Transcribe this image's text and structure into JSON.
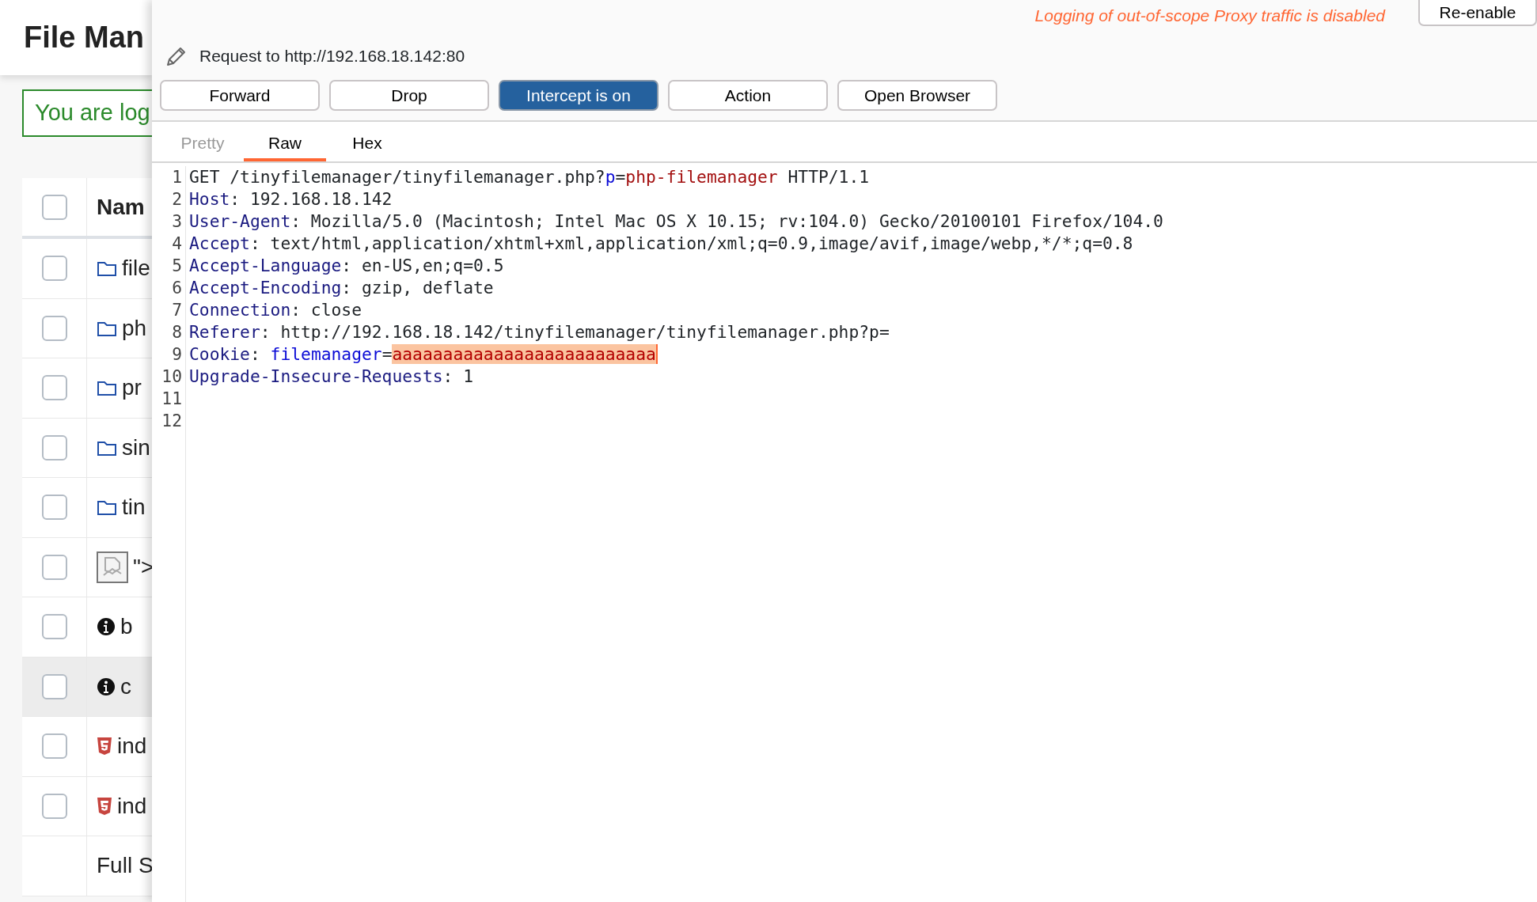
{
  "file_manager": {
    "title": "File Man",
    "alert": "You are log",
    "header": {
      "label": "Nam",
      "checked": false
    },
    "rows": [
      {
        "kind": "folder",
        "name": "file",
        "checked": false,
        "selected": false
      },
      {
        "kind": "folder",
        "name": "ph",
        "checked": false,
        "selected": false
      },
      {
        "kind": "folder",
        "name": "pr",
        "checked": false,
        "selected": false
      },
      {
        "kind": "folder",
        "name": "sin",
        "checked": false,
        "selected": false
      },
      {
        "kind": "folder",
        "name": "tin",
        "checked": false,
        "selected": false
      },
      {
        "kind": "image",
        "name": "\">",
        "checked": false,
        "selected": false
      },
      {
        "kind": "info",
        "name": "b",
        "checked": false,
        "selected": false
      },
      {
        "kind": "info",
        "name": "c",
        "checked": false,
        "selected": true
      },
      {
        "kind": "html",
        "name": "ind",
        "checked": false,
        "selected": false
      },
      {
        "kind": "html",
        "name": "ind",
        "checked": false,
        "selected": false
      },
      {
        "kind": "footer",
        "name": "Full S"
      }
    ]
  },
  "proxy": {
    "logging_notice": "Logging of out-of-scope Proxy traffic is disabled",
    "reenable_button": "Re-enable",
    "request_title": "Request to http://192.168.18.142:80",
    "buttons": [
      {
        "label": "Forward",
        "active": false
      },
      {
        "label": "Drop",
        "active": false
      },
      {
        "label": "Intercept is on",
        "active": true
      },
      {
        "label": "Action",
        "active": false
      },
      {
        "label": "Open Browser",
        "active": false
      }
    ],
    "tabs": [
      {
        "label": "Pretty",
        "selected": false,
        "disabled": true
      },
      {
        "label": "Raw",
        "selected": true,
        "disabled": false
      },
      {
        "label": "Hex",
        "selected": false,
        "disabled": false
      }
    ],
    "lines": [
      {
        "number": "1",
        "tokens": [
          {
            "kind": "plain",
            "text": "GET /tinyfilemanager/tinyfilemanager.php?"
          },
          {
            "kind": "param_name",
            "text": "p"
          },
          {
            "kind": "plain",
            "text": "="
          },
          {
            "kind": "param_value",
            "text": "php-filemanager"
          },
          {
            "kind": "plain",
            "text": " HTTP/1.1"
          }
        ]
      },
      {
        "number": "2",
        "tokens": [
          {
            "kind": "header",
            "text": "Host"
          },
          {
            "kind": "plain",
            "text": ": 192.168.18.142"
          }
        ]
      },
      {
        "number": "3",
        "tokens": [
          {
            "kind": "header",
            "text": "User-Agent"
          },
          {
            "kind": "plain",
            "text": ": Mozilla/5.0 (Macintosh; Intel Mac OS X 10.15; rv:104.0) Gecko/20100101 Firefox/104.0"
          }
        ]
      },
      {
        "number": "4",
        "tokens": [
          {
            "kind": "header",
            "text": "Accept"
          },
          {
            "kind": "plain",
            "text": ": text/html,application/xhtml+xml,application/xml;q=0.9,image/avif,image/webp,*/*;q=0.8"
          }
        ]
      },
      {
        "number": "5",
        "tokens": [
          {
            "kind": "header",
            "text": "Accept-Language"
          },
          {
            "kind": "plain",
            "text": ": en-US,en;q=0.5"
          }
        ]
      },
      {
        "number": "6",
        "tokens": [
          {
            "kind": "header",
            "text": "Accept-Encoding"
          },
          {
            "kind": "plain",
            "text": ": gzip, deflate"
          }
        ]
      },
      {
        "number": "7",
        "tokens": [
          {
            "kind": "header",
            "text": "Connection"
          },
          {
            "kind": "plain",
            "text": ": close"
          }
        ]
      },
      {
        "number": "8",
        "tokens": [
          {
            "kind": "header",
            "text": "Referer"
          },
          {
            "kind": "plain",
            "text": ": http://192.168.18.142/tinyfilemanager/tinyfilemanager.php?p="
          }
        ]
      },
      {
        "number": "9",
        "tokens": [
          {
            "kind": "header",
            "text": "Cookie"
          },
          {
            "kind": "plain",
            "text": ": "
          },
          {
            "kind": "param_name",
            "text": "filemanager"
          },
          {
            "kind": "plain",
            "text": "="
          },
          {
            "kind": "highlight",
            "text": "aaaaaaaaaaaaaaaaaaaaaaaaaa"
          }
        ]
      },
      {
        "number": "10",
        "tokens": [
          {
            "kind": "header",
            "text": "Upgrade-Insecure-Requests"
          },
          {
            "kind": "plain",
            "text": ": 1"
          }
        ]
      },
      {
        "number": "11"
      },
      {
        "number": "12"
      }
    ]
  }
}
